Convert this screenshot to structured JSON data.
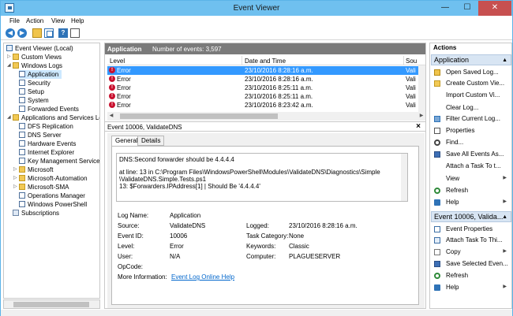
{
  "window": {
    "title": "Event Viewer",
    "min": "—",
    "max": "☐",
    "close": "✕"
  },
  "menu": {
    "file": "File",
    "action": "Action",
    "view": "View",
    "help": "Help"
  },
  "tree": {
    "root": "Event Viewer (Local)",
    "custom_views": "Custom Views",
    "windows_logs": "Windows Logs",
    "application": "Application",
    "security": "Security",
    "setup": "Setup",
    "system": "System",
    "forwarded": "Forwarded Events",
    "apps_services": "Applications and Services Logs",
    "dfs": "DFS Replication",
    "dns": "DNS Server",
    "hardware": "Hardware Events",
    "ie": "Internet Explorer",
    "kms": "Key Management Service",
    "microsoft": "Microsoft",
    "automation": "Microsoft-Automation",
    "sma": "Microsoft-SMA",
    "opsmgr": "Operations Manager",
    "powershell": "Windows PowerShell",
    "subscriptions": "Subscriptions"
  },
  "list": {
    "log_name": "Application",
    "count_text": "Number of events: 3,597",
    "col_level": "Level",
    "col_date": "Date and Time",
    "col_source": "Sou",
    "rows": [
      {
        "level": "Error",
        "date": "23/10/2016 8:28:16 a.m.",
        "source": "Vali"
      },
      {
        "level": "Error",
        "date": "23/10/2016 8:28:16 a.m.",
        "source": "Vali"
      },
      {
        "level": "Error",
        "date": "23/10/2016 8:25:11 a.m.",
        "source": "Vali"
      },
      {
        "level": "Error",
        "date": "23/10/2016 8:25:11 a.m.",
        "source": "Vali"
      },
      {
        "level": "Error",
        "date": "23/10/2016 8:23:42 a.m.",
        "source": "Vali"
      }
    ]
  },
  "detail": {
    "header": "Event 10006, ValidateDNS",
    "close": "×",
    "tab_general": "General",
    "tab_details": "Details",
    "description": {
      "line1": "DNS:Second forwarder should be 4.4.4.4",
      "line2": "at line: 13 in C:\\Program Files\\WindowsPowerShell\\Modules\\ValidateDNS\\Diagnostics\\Simple",
      "line3": "\\ValidateDNS.Simple.Tests.ps1",
      "line4": "13:          $Forwarders.IPAddress[1] | Should Be '4.4.4.4'"
    },
    "props": {
      "log_name_label": "Log Name:",
      "log_name": "Application",
      "source_label": "Source:",
      "source": "ValidateDNS",
      "logged_label": "Logged:",
      "logged": "23/10/2016 8:28:16 a.m.",
      "event_id_label": "Event ID:",
      "event_id": "10006",
      "task_label": "Task Category:",
      "task": "None",
      "level_label": "Level:",
      "level": "Error",
      "keywords_label": "Keywords:",
      "keywords": "Classic",
      "user_label": "User:",
      "user": "N/A",
      "computer_label": "Computer:",
      "computer": "PLAGUESERVER",
      "opcode_label": "OpCode:",
      "more_label": "More Information:",
      "more_link": "Event Log Online Help"
    }
  },
  "actions": {
    "title": "Actions",
    "section1": "Application",
    "open_saved": "Open Saved Log...",
    "create_view": "Create Custom Vie...",
    "import_view": "Import Custom Vi...",
    "clear_log": "Clear Log...",
    "filter": "Filter Current Log...",
    "properties": "Properties",
    "find": "Find...",
    "save_all": "Save All Events As...",
    "attach_task": "Attach a Task To t...",
    "view": "View",
    "refresh": "Refresh",
    "help": "Help",
    "section2": "Event 10006, Valida...",
    "event_props": "Event Properties",
    "attach_event_task": "Attach Task To Thi...",
    "copy": "Copy",
    "save_selected": "Save Selected Even...",
    "refresh2": "Refresh",
    "help2": "Help"
  }
}
